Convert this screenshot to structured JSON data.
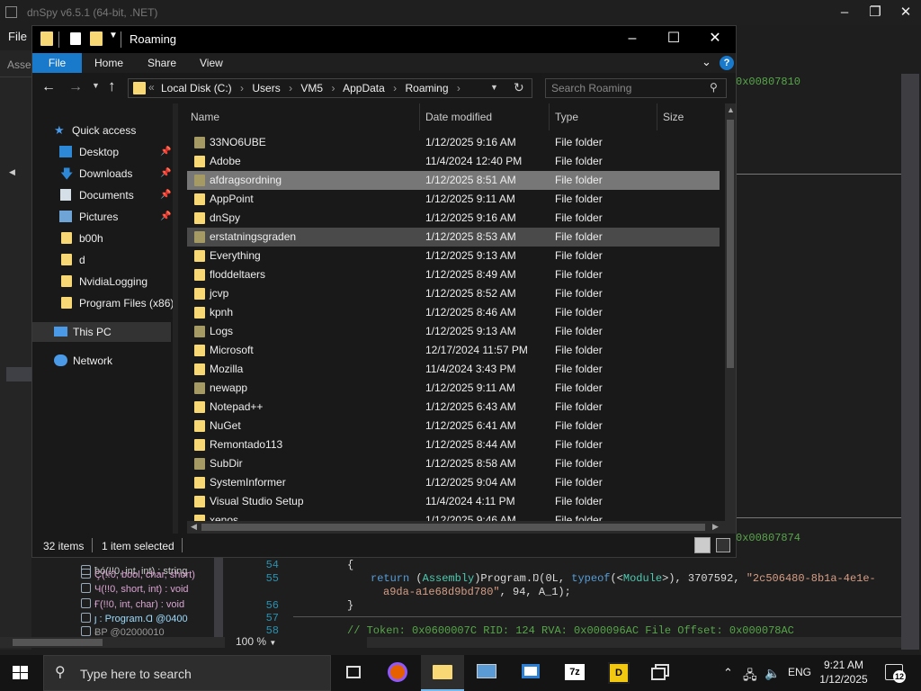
{
  "dnspy": {
    "title": "dnSpy v6.5.1 (64-bit, .NET)",
    "menu_file": "File",
    "assembly_tab": "Asse",
    "hex_top": "0x00807810",
    "hex_bottom": "0x00807874",
    "tree": [
      "ƀó(!!0, int, int) : string",
      "Ç(!!0, bool, char, short)",
      "Ч(!!0, short, int) : void",
      "Ғ(!!0, int, char) : void",
      "ȷ : Program.Ɑ @0400",
      "ɃΡ @02000010"
    ],
    "code": {
      "lines": [
        {
          "num": "54",
          "text": "{"
        },
        {
          "num": "55",
          "text_return": "return",
          "text_cast_open": " (",
          "text_type": "Assembly",
          "text_mid": ")Program.Ŋ(0L, ",
          "text_typeof": "typeof",
          "text_mod_open": "(<",
          "text_module": "Module",
          "text_mod_close": ">), 3707592, ",
          "text_str": "\"2c506480-8b1a-4e1e-",
          "text_str2": "a9da-a1e68d9bd780\"",
          "text_end": ", 94, A_1);"
        },
        {
          "num": "56",
          "text": "}"
        },
        {
          "num": "57",
          "text": ""
        },
        {
          "num": "58",
          "text": "// Token: 0x0600007C RID: 124 RVA: 0x000096AC File Offset: 0x000078AC"
        }
      ]
    },
    "zoom": "100 %"
  },
  "explorer": {
    "title": "Roaming",
    "ribbon_tabs": [
      "File",
      "Home",
      "Share",
      "View"
    ],
    "breadcrumb": [
      "Local Disk (C:)",
      "Users",
      "VM5",
      "AppData",
      "Roaming"
    ],
    "search_placeholder": "Search Roaming",
    "nav": {
      "quick_access": "Quick access",
      "items": [
        "Desktop",
        "Downloads",
        "Documents",
        "Pictures",
        "b00h",
        "d",
        "NvidiaLogging",
        "Program Files (x86)"
      ],
      "this_pc": "This PC",
      "network": "Network"
    },
    "columns": [
      "Name",
      "Date modified",
      "Type",
      "Size"
    ],
    "files": [
      {
        "name": "33NO6UBE",
        "date": "1/12/2025 9:16 AM",
        "type": "File folder"
      },
      {
        "name": "Adobe",
        "date": "11/4/2024 12:40 PM",
        "type": "File folder"
      },
      {
        "name": "afdragsordning",
        "date": "1/12/2025 8:51 AM",
        "type": "File folder"
      },
      {
        "name": "AppPoint",
        "date": "1/12/2025 9:11 AM",
        "type": "File folder"
      },
      {
        "name": "dnSpy",
        "date": "1/12/2025 9:16 AM",
        "type": "File folder"
      },
      {
        "name": "erstatningsgraden",
        "date": "1/12/2025 8:53 AM",
        "type": "File folder"
      },
      {
        "name": "Everything",
        "date": "1/12/2025 9:13 AM",
        "type": "File folder"
      },
      {
        "name": "floddeltaers",
        "date": "1/12/2025 8:49 AM",
        "type": "File folder"
      },
      {
        "name": "jcvp",
        "date": "1/12/2025 8:52 AM",
        "type": "File folder"
      },
      {
        "name": "kpnh",
        "date": "1/12/2025 8:46 AM",
        "type": "File folder"
      },
      {
        "name": "Logs",
        "date": "1/12/2025 9:13 AM",
        "type": "File folder"
      },
      {
        "name": "Microsoft",
        "date": "12/17/2024 11:57 PM",
        "type": "File folder"
      },
      {
        "name": "Mozilla",
        "date": "11/4/2024 3:43 PM",
        "type": "File folder"
      },
      {
        "name": "newapp",
        "date": "1/12/2025 9:11 AM",
        "type": "File folder"
      },
      {
        "name": "Notepad++",
        "date": "1/12/2025 6:43 AM",
        "type": "File folder"
      },
      {
        "name": "NuGet",
        "date": "1/12/2025 6:41 AM",
        "type": "File folder"
      },
      {
        "name": "Remontado113",
        "date": "1/12/2025 8:44 AM",
        "type": "File folder"
      },
      {
        "name": "SubDir",
        "date": "1/12/2025 8:58 AM",
        "type": "File folder"
      },
      {
        "name": "SystemInformer",
        "date": "1/12/2025 9:04 AM",
        "type": "File folder"
      },
      {
        "name": "Visual Studio Setup",
        "date": "11/4/2024 4:11 PM",
        "type": "File folder"
      },
      {
        "name": "xenos",
        "date": "1/12/2025 9:46 AM",
        "type": "File folder"
      }
    ],
    "status_count": "32 items",
    "status_selected": "1 item selected"
  },
  "taskbar": {
    "search_placeholder": "Type here to search",
    "language": "ENG",
    "time": "9:21 AM",
    "date": "1/12/2025",
    "notifications": "12",
    "apps": [
      "task-view-icon",
      "firefox-icon",
      "file-explorer-icon",
      "network-tool-icon",
      "remote-desktop-icon",
      "7zip-icon",
      "dnspy-icon",
      "window-stack-icon"
    ]
  }
}
